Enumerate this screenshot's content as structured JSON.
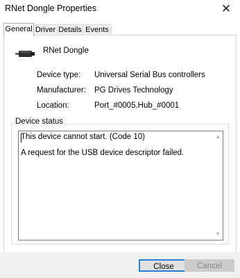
{
  "window": {
    "title": "RNet Dongle Properties",
    "close_glyph": "✕"
  },
  "tabs": [
    {
      "label": "General",
      "active": true
    },
    {
      "label": "Driver",
      "active": false
    },
    {
      "label": "Details",
      "active": false
    },
    {
      "label": "Events",
      "active": false
    }
  ],
  "device": {
    "name": "RNet Dongle",
    "icon": "usb-plug-icon"
  },
  "properties": [
    {
      "label": "Device type:",
      "value": "Universal Serial Bus controllers"
    },
    {
      "label": "Manufacturer:",
      "value": "PG Drives Technology"
    },
    {
      "label": "Location:",
      "value": "Port_#0005.Hub_#0001"
    }
  ],
  "status": {
    "legend": "Device status",
    "lines": [
      "This device cannot start. (Code 10)",
      "A request for the USB device descriptor failed."
    ]
  },
  "buttons": {
    "close": "Close",
    "cancel": "Cancel"
  },
  "colors": {
    "focus_border": "#2c7fd0",
    "dialog_footer": "#f0f0f0"
  }
}
